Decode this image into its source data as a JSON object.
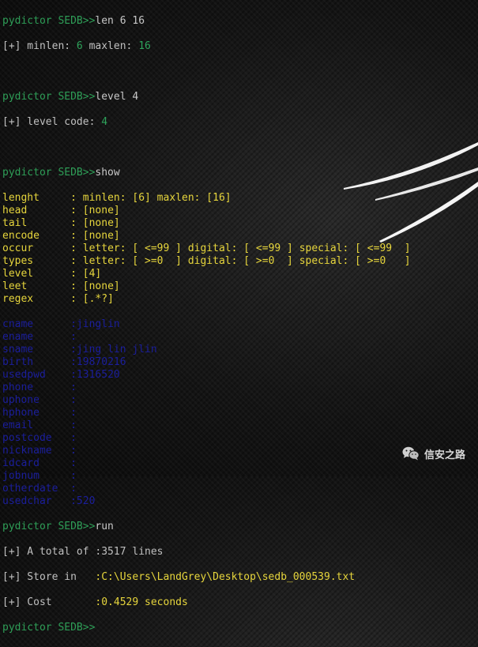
{
  "session": {
    "prompt": "pydictor SEDB>>",
    "commands": {
      "len": "len 6 16",
      "level": "level 4",
      "show": "show",
      "run": "run"
    },
    "len_result": {
      "prefix": "[+] minlen: ",
      "min": "6",
      "mid": " maxlen: ",
      "max": "16"
    },
    "level_result": {
      "prefix": "[+] level code: ",
      "code": "4"
    }
  },
  "show_yellow": [
    {
      "key": "lenght   ",
      "value": "minlen: [6] maxlen: [16]"
    },
    {
      "key": "head     ",
      "value": "[none]"
    },
    {
      "key": "tail     ",
      "value": "[none]"
    },
    {
      "key": "encode   ",
      "value": "[none]"
    },
    {
      "key": "occur    ",
      "value": "letter: [ <=99 ] digital: [ <=99 ] special: [ <=99  ]"
    },
    {
      "key": "types    ",
      "value": "letter: [ >=0  ] digital: [ >=0  ] special: [ >=0   ]"
    },
    {
      "key": "level    ",
      "value": "[4]"
    },
    {
      "key": "leet     ",
      "value": "[none]"
    },
    {
      "key": "regex    ",
      "value": "[.*?]"
    }
  ],
  "show_blue": [
    {
      "key": "cname    ",
      "value": ":jinglin"
    },
    {
      "key": "ename    ",
      "value": ":"
    },
    {
      "key": "sname    ",
      "value": ":jing lin jlin"
    },
    {
      "key": "birth    ",
      "value": ":19870216"
    },
    {
      "key": "usedpwd  ",
      "value": ":1316520"
    },
    {
      "key": "phone    ",
      "value": ":"
    },
    {
      "key": "uphone   ",
      "value": ":"
    },
    {
      "key": "hphone   ",
      "value": ":"
    },
    {
      "key": "email    ",
      "value": ":"
    },
    {
      "key": "postcode ",
      "value": ":"
    },
    {
      "key": "nickname ",
      "value": ":"
    },
    {
      "key": "idcard   ",
      "value": ":"
    },
    {
      "key": "jobnum   ",
      "value": ":"
    },
    {
      "key": "otherdate",
      "value": ":"
    },
    {
      "key": "usedchar ",
      "value": ":520"
    }
  ],
  "run_result": {
    "total_prefix": "[+] A total of ",
    "total_value": ":3517 lines",
    "store_prefix": "[+] Store in   ",
    "store_value": ":C:\\Users\\LandGrey\\Desktop\\sedb_000539.txt",
    "cost_prefix": "[+] Cost       ",
    "cost_value": ":0.4529 seconds"
  },
  "watermark": {
    "text": "信安之路",
    "icon": "wechat-icon"
  },
  "colors": {
    "prompt": "#2e9e57",
    "yellow": "#e6d53c",
    "blue": "#1b1e9c",
    "grey": "#c0c0c0",
    "background": "#101010"
  }
}
